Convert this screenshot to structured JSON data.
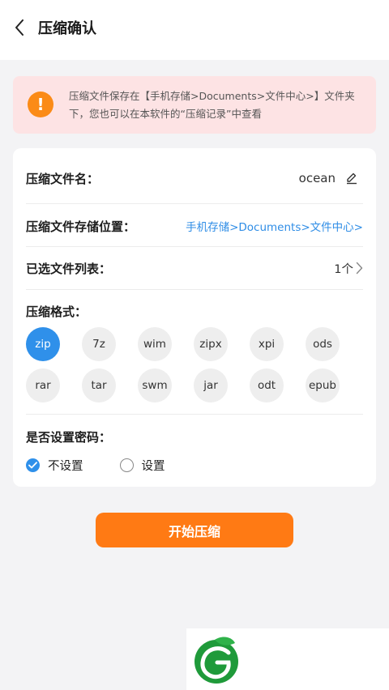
{
  "header": {
    "title": "压缩确认",
    "back_icon": "chevron-left-icon"
  },
  "notice": {
    "icon": "warning-icon",
    "icon_glyph": "!",
    "text": "压缩文件保存在【手机存储>Documents>文件中心>】文件夹下，您也可以在本软件的“压缩记录”中查看",
    "background": "#fde3e4",
    "icon_color": "#fb8b17"
  },
  "form": {
    "filename_label": "压缩文件名：",
    "filename_value": "ocean",
    "edit_icon": "pencil-icon",
    "location_label": "压缩文件存储位置：",
    "location_value": "手机存储>Documents>文件中心>",
    "files_label": "已选文件列表：",
    "files_count": "1个",
    "format_label": "压缩格式：",
    "formats": [
      "zip",
      "7z",
      "wim",
      "zipx",
      "xpi",
      "ods",
      "rar",
      "tar",
      "swm",
      "jar",
      "odt",
      "epub"
    ],
    "selected_format": "zip",
    "password_label": "是否设置密码：",
    "password_options": [
      {
        "label": "不设置",
        "checked": true
      },
      {
        "label": "设置",
        "checked": false
      }
    ]
  },
  "actions": {
    "start_label": "开始压缩"
  },
  "colors": {
    "accent": "#2f90ea",
    "button": "#ff7a14",
    "link": "#2f8de6"
  },
  "watermark": {
    "icon": "leaf-logo-icon"
  }
}
